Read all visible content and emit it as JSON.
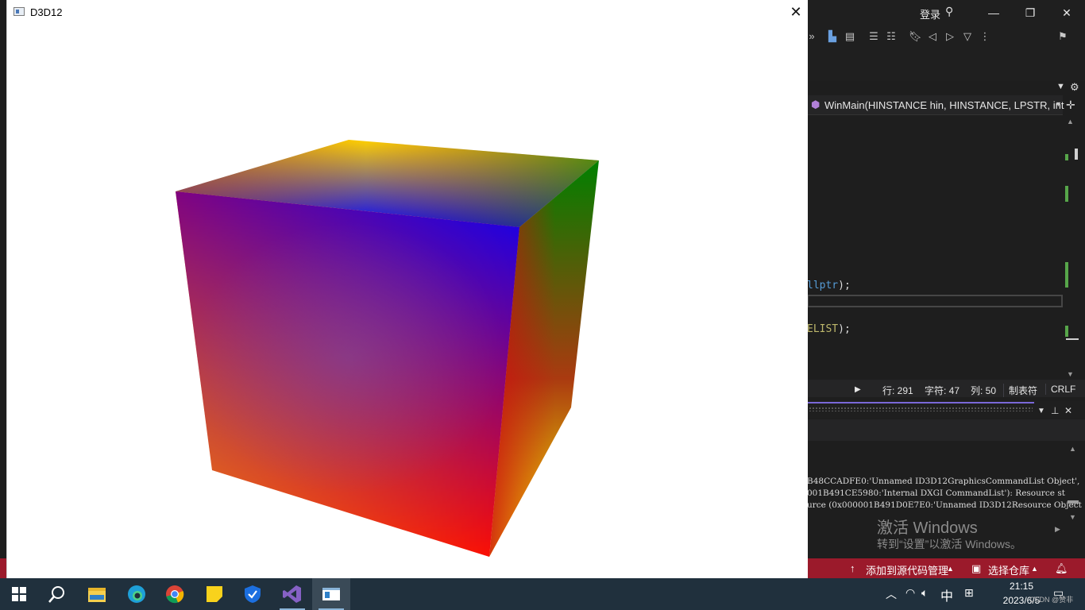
{
  "vs": {
    "login_label": "登录",
    "navbar_text": "WinMain(HINSTANCE hin, HINSTANCE, LPSTR, int",
    "code_line1_kw": "llptr",
    "code_line1_rest": ");",
    "code_line2_mac": "ELIST",
    "code_line2_rest": ");",
    "status_row": {
      "line": "行: 291",
      "char": "字符: 47",
      "col": "列: 50",
      "tabs": "制表符",
      "eol": "CRLF"
    },
    "output_lines": [
      "B48CCADFE0:'Unnamed ID3D12GraphicsCommandList Object',",
      "001B491CE5980:'Internal DXGI CommandList'): Resource st",
      "urce (0x000001B491D0E7E0:'Unnamed ID3D12Resource Object"
    ],
    "watermark_title": "激活 Windows",
    "watermark_sub": "转到“设置”以激活 Windows。",
    "statusbar": {
      "source_control": "添加到源代码管理",
      "repo": "选择仓库"
    }
  },
  "d3d_window": {
    "title": "D3D12",
    "close_glyph": "✕"
  },
  "cube": {
    "front_colors": {
      "top_left": "#800080",
      "top_right": "#0000ff",
      "bottom_left": "#ff8800",
      "bottom_right": "#ff0000"
    },
    "right_colors": {
      "top": "#008000",
      "bottom": "#ffff00"
    },
    "top_colors": {
      "back": "#ffd000",
      "front": "#0000ff"
    }
  },
  "taskbar": {
    "apps": [
      "start-button",
      "search-button",
      "file-explorer",
      "edge",
      "chrome",
      "sticky-notes",
      "security",
      "visual-studio",
      "d3d12-app"
    ],
    "ime": "中",
    "clock_time": "21:15",
    "clock_date": "2023/6/5",
    "watermark": "CSDN @赞非"
  }
}
